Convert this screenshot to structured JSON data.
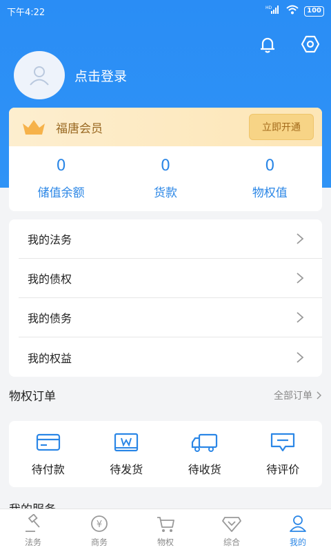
{
  "status_bar": {
    "time": "下午4:22",
    "network": "HD",
    "battery": "100"
  },
  "profile": {
    "login_text": "点击登录"
  },
  "member": {
    "title": "福唐会员",
    "open_button": "立即开通",
    "stats": [
      {
        "value": "0",
        "label": "储值余额"
      },
      {
        "value": "0",
        "label": "货款"
      },
      {
        "value": "0",
        "label": "物权值"
      }
    ]
  },
  "menu": {
    "items": [
      {
        "label": "我的法务"
      },
      {
        "label": "我的债权"
      },
      {
        "label": "我的债务"
      },
      {
        "label": "我的权益"
      }
    ]
  },
  "orders": {
    "title": "物权订单",
    "all_label": "全部订单",
    "items": [
      {
        "label": "待付款",
        "icon": "card-icon"
      },
      {
        "label": "待发货",
        "icon": "box-icon"
      },
      {
        "label": "待收货",
        "icon": "truck-icon"
      },
      {
        "label": "待评价",
        "icon": "comment-icon"
      }
    ]
  },
  "services": {
    "title": "我的服务"
  },
  "tabbar": {
    "items": [
      {
        "label": "法务",
        "icon": "gavel-icon",
        "active": false
      },
      {
        "label": "商务",
        "icon": "yen-icon",
        "active": false
      },
      {
        "label": "物权",
        "icon": "cart-icon",
        "active": false
      },
      {
        "label": "综合",
        "icon": "diamond-icon",
        "active": false
      },
      {
        "label": "我的",
        "icon": "user-icon",
        "active": true
      }
    ]
  },
  "colors": {
    "primary": "#2a8df5",
    "accent_blue": "#2a86e6",
    "gold": "#9a6a24"
  }
}
